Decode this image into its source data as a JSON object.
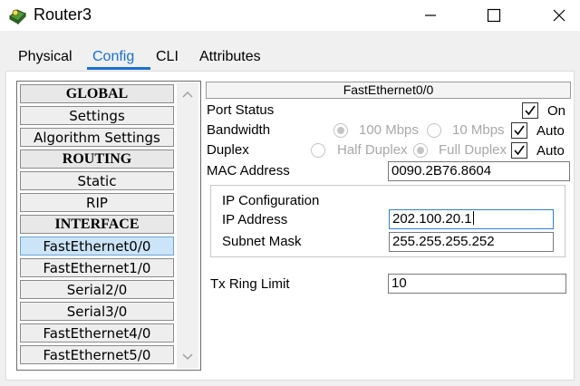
{
  "window": {
    "title": "Router3",
    "minimize_icon": "minimize-icon",
    "maximize_icon": "maximize-icon",
    "close_icon": "close-icon",
    "app_icon": "router-app-icon"
  },
  "tabs": [
    {
      "label": "Physical"
    },
    {
      "label": "Config",
      "active": true
    },
    {
      "label": "CLI"
    },
    {
      "label": "Attributes"
    }
  ],
  "nav": {
    "items": [
      {
        "label": "GLOBAL",
        "header": true
      },
      {
        "label": "Settings"
      },
      {
        "label": "Algorithm Settings"
      },
      {
        "label": "ROUTING",
        "header": true
      },
      {
        "label": "Static"
      },
      {
        "label": "RIP"
      },
      {
        "label": "INTERFACE",
        "header": true
      },
      {
        "label": "FastEthernet0/0",
        "selected": true
      },
      {
        "label": "FastEthernet1/0"
      },
      {
        "label": "Serial2/0"
      },
      {
        "label": "Serial3/0"
      },
      {
        "label": "FastEthernet4/0"
      },
      {
        "label": "FastEthernet5/0"
      }
    ]
  },
  "interface": {
    "title": "FastEthernet0/0",
    "port_status": {
      "label": "Port Status",
      "on_label": "On",
      "checked": true
    },
    "bandwidth": {
      "label": "Bandwidth",
      "opt1": "100 Mbps",
      "opt2": "10 Mbps",
      "selected": "100 Mbps",
      "auto_label": "Auto",
      "auto_checked": true
    },
    "duplex": {
      "label": "Duplex",
      "opt1": "Half Duplex",
      "opt2": "Full Duplex",
      "selected": "Full Duplex",
      "auto_label": "Auto",
      "auto_checked": true
    },
    "mac": {
      "label": "MAC Address",
      "value": "0090.2B76.8604"
    },
    "ip_config": {
      "title": "IP Configuration",
      "ip_label": "IP Address",
      "ip_value": "202.100.20.1",
      "mask_label": "Subnet Mask",
      "mask_value": "255.255.255.252"
    },
    "tx_ring": {
      "label": "Tx Ring Limit",
      "value": "10"
    }
  },
  "colors": {
    "accent": "#1a6fd1",
    "selected_bg": "#cce4f7"
  }
}
